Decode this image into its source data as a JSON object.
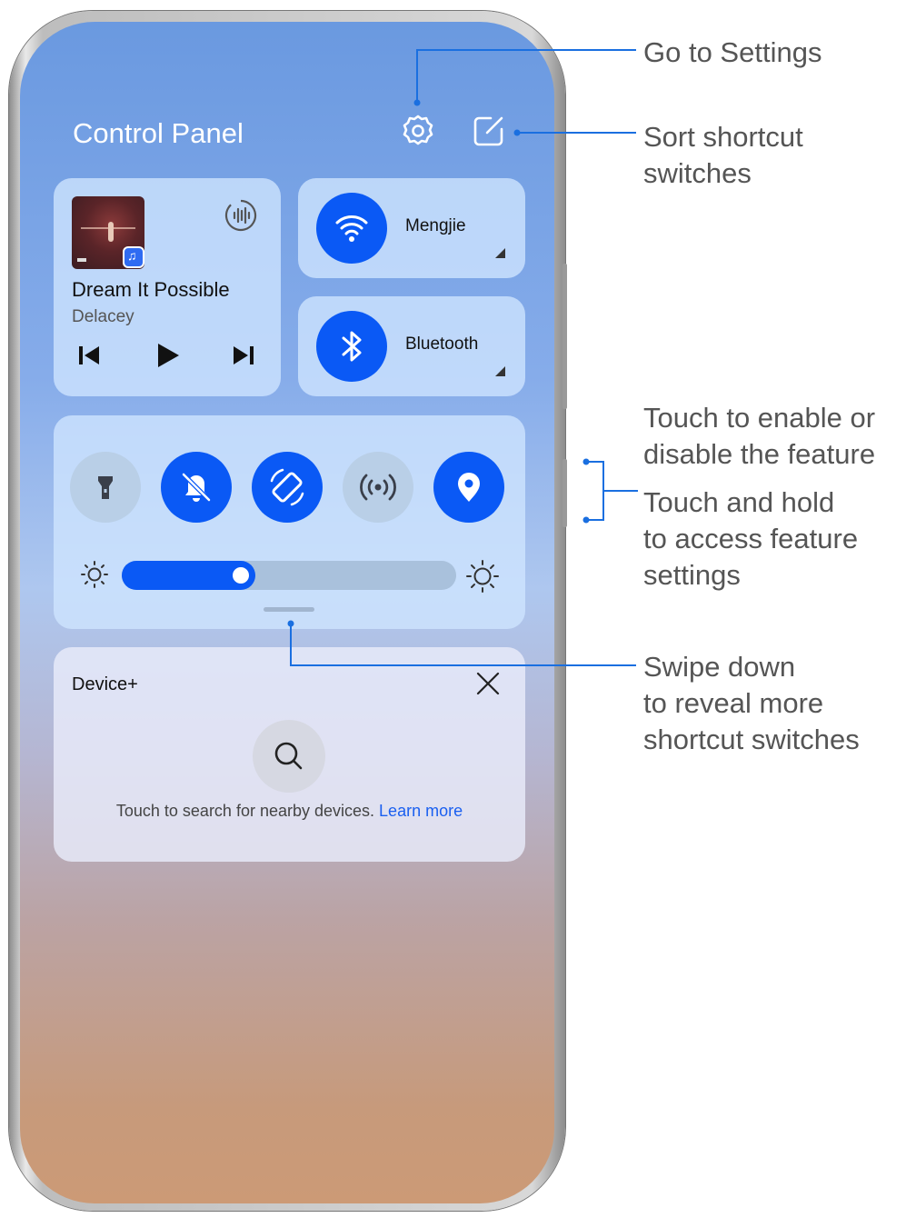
{
  "header": {
    "title": "Control Panel",
    "settings_icon": "gear-icon",
    "edit_icon": "edit-square-icon"
  },
  "media": {
    "song_title": "Dream It Possible",
    "artist": "Delacey",
    "controls": [
      "previous-icon",
      "play-icon",
      "next-icon"
    ]
  },
  "toggles": {
    "wifi": {
      "label": "Mengjie",
      "icon": "wifi-icon",
      "active": true
    },
    "bluetooth": {
      "label": "Bluetooth",
      "icon": "bluetooth-icon",
      "active": true
    }
  },
  "shortcut_switches": [
    {
      "name": "flashlight",
      "icon": "flashlight-icon",
      "active": false
    },
    {
      "name": "silent",
      "icon": "bell-off-icon",
      "active": true
    },
    {
      "name": "auto-rotate",
      "icon": "rotate-icon",
      "active": true
    },
    {
      "name": "hotspot",
      "icon": "hotspot-icon",
      "active": false
    },
    {
      "name": "location",
      "icon": "location-pin-icon",
      "active": true
    }
  ],
  "brightness": {
    "level": 0.4
  },
  "device_plus": {
    "title": "Device+",
    "hint": "Touch to search for nearby devices.",
    "link": "Learn more"
  },
  "callouts": {
    "settings": "Go to Settings",
    "sort_line1": "Sort shortcut",
    "sort_line2": "switches",
    "toggle_line1": "Touch to enable or",
    "toggle_line2": "disable the feature",
    "hold_line1": "Touch and hold",
    "hold_line2": "to access feature",
    "hold_line3": "settings",
    "swipe_line1": "Swipe down",
    "swipe_line2": "to reveal more",
    "swipe_line3": "shortcut switches"
  },
  "colors": {
    "accent": "#0a59f5",
    "callout_line": "#1a6fe0"
  }
}
